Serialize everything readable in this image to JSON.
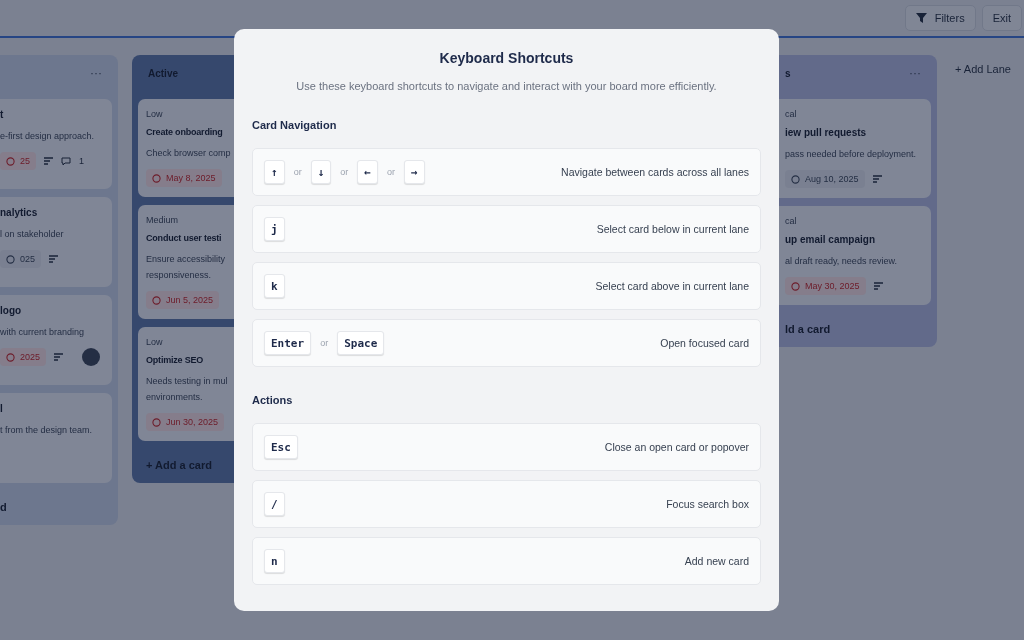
{
  "toolbar": {
    "buttons": [
      {
        "label": "Filters",
        "kind": "filter"
      },
      {
        "label": "Exit",
        "kind": "plain"
      }
    ]
  },
  "lanes": [
    {
      "menu": "···",
      "add_label": "d",
      "cards": [
        {
          "title": "t",
          "description": "e-first design approach.",
          "date": {
            "text": "25",
            "overdue": true
          },
          "attachments": true,
          "comments": "1",
          "avatar": false
        },
        {
          "title": "nalytics",
          "description": "l on stakeholder",
          "date": {
            "text": "025",
            "overdue": false
          },
          "attachments": true,
          "avatar": false
        },
        {
          "title": "logo",
          "description": "with current branding",
          "date": {
            "text": "2025",
            "overdue": true
          },
          "attachments": true,
          "avatar": true
        },
        {
          "title": "l",
          "description": "t from the design team.",
          "attachments": false,
          "avatar": false
        }
      ]
    },
    {
      "title": "Active",
      "add_label": "+ Add a card",
      "cards": [
        {
          "priority": "Low",
          "title": "Create onboarding",
          "description": "Check browser comp",
          "date": {
            "text": "May 8, 2025",
            "overdue": true
          },
          "attachments": false,
          "avatar": false
        },
        {
          "priority": "Medium",
          "title": "Conduct user testi",
          "description": "Ensure accessibility responsiveness.",
          "date": {
            "text": "Jun 5, 2025",
            "overdue": true
          },
          "attachments": false,
          "avatar": false
        },
        {
          "priority": "Low",
          "title": "Optimize SEO",
          "description": "Needs testing in mul environments.",
          "date": {
            "text": "Jun 30, 2025",
            "overdue": true
          },
          "attachments": false,
          "avatar": false
        }
      ]
    },
    {
      "title": "s",
      "menu": "···",
      "add_label": "ld a card",
      "cards": [
        {
          "priority": "cal",
          "title": "iew pull requests",
          "description": "pass needed before deployment.",
          "date": {
            "text": "Aug 10, 2025",
            "overdue": false
          },
          "attachments": true,
          "avatar": false
        },
        {
          "priority": "cal",
          "title": "up email campaign",
          "description": "al draft ready, needs review.",
          "date": {
            "text": "May 30, 2025",
            "overdue": true
          },
          "attachments": true,
          "avatar": false
        }
      ]
    }
  ],
  "add_lane": "+ Add Lane",
  "dialog": {
    "title": "Keyboard Shortcuts",
    "subtitle": "Use these keyboard shortcuts to navigate and interact with your board more efficiently.",
    "sections": [
      {
        "title": "Card Navigation",
        "shortcuts": [
          {
            "keys": [
              "↑",
              "↓",
              "←",
              "→"
            ],
            "separators": [
              "or",
              "or",
              "or"
            ],
            "description": "Navigate between cards across all lanes"
          },
          {
            "keys": [
              "j"
            ],
            "description": "Select card below in current lane"
          },
          {
            "keys": [
              "k"
            ],
            "description": "Select card above in current lane"
          },
          {
            "keys": [
              "Enter",
              "Space"
            ],
            "separators": [
              "or"
            ],
            "description": "Open focused card"
          }
        ]
      },
      {
        "title": "Actions",
        "shortcuts": [
          {
            "keys": [
              "Esc"
            ],
            "description": "Close an open card or popover"
          },
          {
            "keys": [
              "/"
            ],
            "description": "Focus search box"
          },
          {
            "keys": [
              "n"
            ],
            "description": "Add new card"
          }
        ]
      }
    ]
  }
}
